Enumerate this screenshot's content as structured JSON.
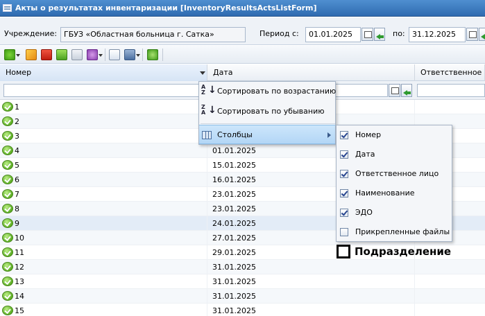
{
  "window": {
    "title": "Акты о результатах инвентаризации [InventoryResultsActsListForm]"
  },
  "filter": {
    "institution_label": "Учреждение:",
    "institution_value": "ГБУЗ «Областная больница г. Сатка»",
    "period_label": "Период с:",
    "period_from": "01.01.2025",
    "period_to_label": "по:",
    "period_to": "31.12.2025"
  },
  "toolbar": {
    "icons": [
      "add-icon",
      "edit-icon",
      "delete-icon",
      "approve-icon",
      "chart-icon",
      "settings-icon",
      "export-icon",
      "print-icon",
      "refresh-icon"
    ]
  },
  "grid": {
    "columns": [
      "Номер",
      "Дата",
      "Ответственное лицо"
    ],
    "rows": [
      {
        "num": "1",
        "date": ""
      },
      {
        "num": "2",
        "date": ""
      },
      {
        "num": "3",
        "date": ""
      },
      {
        "num": "4",
        "date": "01.01.2025"
      },
      {
        "num": "5",
        "date": "15.01.2025"
      },
      {
        "num": "6",
        "date": "16.01.2025"
      },
      {
        "num": "7",
        "date": "23.01.2025"
      },
      {
        "num": "8",
        "date": "23.01.2025"
      },
      {
        "num": "9",
        "date": "24.01.2025"
      },
      {
        "num": "10",
        "date": "27.01.2025"
      },
      {
        "num": "11",
        "date": "29.01.2025"
      },
      {
        "num": "12",
        "date": "31.01.2025"
      },
      {
        "num": "13",
        "date": "31.01.2025"
      },
      {
        "num": "14",
        "date": "31.01.2025"
      },
      {
        "num": "15",
        "date": "31.01.2025"
      }
    ],
    "selected_row": "9"
  },
  "column_menu": {
    "sort_asc": "Сортировать по возрастанию",
    "sort_desc": "Сортировать по убыванию",
    "columns": "Столбцы"
  },
  "columns_submenu": {
    "items": [
      {
        "label": "Номер",
        "checked": true
      },
      {
        "label": "Дата",
        "checked": true
      },
      {
        "label": "Ответственное лицо",
        "checked": true
      },
      {
        "label": "Наименование",
        "checked": true
      },
      {
        "label": "ЭДО",
        "checked": true
      },
      {
        "label": "Прикрепленные файлы",
        "checked": false
      }
    ]
  },
  "extra_item": {
    "label": "Подразделение",
    "checked": false
  }
}
